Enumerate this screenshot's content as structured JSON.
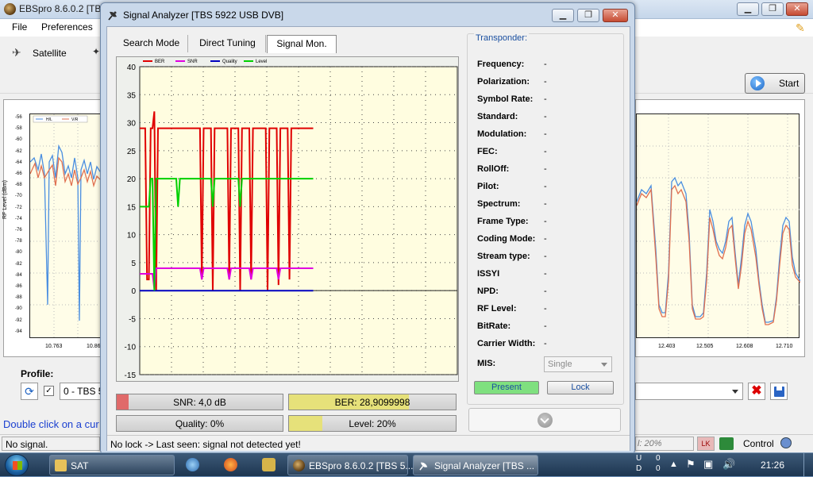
{
  "main_window": {
    "title": "EBSpro 8.6.0.2 [TBS",
    "menu": [
      "File",
      "Preferences"
    ],
    "toolbar_satellite": "Satellite",
    "start_label": "Start",
    "profile_label": "Profile:",
    "profile_value": "0 - TBS 5",
    "hint_text": "Double click on a cur",
    "status_text": "No signal.",
    "status_level": "l: 20%",
    "status_lk": "LK",
    "control_label": "Control",
    "spectrum_left_ylabel": "RF Level (dBm)",
    "spectrum_left_yticks": [
      "-56",
      "-58",
      "-60",
      "-62",
      "-64",
      "-66",
      "-68",
      "-70",
      "-72",
      "-74",
      "-76",
      "-78",
      "-80",
      "-82",
      "-84",
      "-86",
      "-88",
      "-90",
      "-92",
      "-94"
    ],
    "spectrum_left_xticks": [
      "10.763",
      "10.865"
    ],
    "spectrum_left_legend": [
      "H/L",
      "V/R"
    ],
    "spectrum_right_xticks": [
      "12.403",
      "12.505",
      "12.608",
      "12.710"
    ]
  },
  "dialog": {
    "title": "Signal Analyzer [TBS 5922 USB DVB]",
    "tabs": [
      "Search Mode",
      "Direct Tuning",
      "Signal Mon."
    ],
    "meters": {
      "snr": {
        "label": "SNR: 4,0 dB",
        "fraction": 0.07,
        "color": "#e06a6a"
      },
      "ber": {
        "label": "BER: 28,9099998",
        "fraction": 0.72,
        "color": "#e6e17a"
      },
      "quality": {
        "label": "Quality: 0%",
        "fraction": 0.0,
        "color": "#e06a6a"
      },
      "level": {
        "label": "Level: 20%",
        "fraction": 0.2,
        "color": "#e6e17a"
      }
    },
    "transponder_heading": "Transponder:",
    "transponder": [
      {
        "label": "Frequency:",
        "value": "-"
      },
      {
        "label": "Polarization:",
        "value": "-"
      },
      {
        "label": "Symbol Rate:",
        "value": "-"
      },
      {
        "label": "Standard:",
        "value": "-"
      },
      {
        "label": "Modulation:",
        "value": "-"
      },
      {
        "label": "FEC:",
        "value": "-"
      },
      {
        "label": "RollOff:",
        "value": "-"
      },
      {
        "label": "Pilot:",
        "value": "-"
      },
      {
        "label": "Spectrum:",
        "value": "-"
      },
      {
        "label": "Frame Type:",
        "value": "-"
      },
      {
        "label": "Coding Mode:",
        "value": "-"
      },
      {
        "label": "Stream type:",
        "value": "-"
      },
      {
        "label": "ISSYI",
        "value": "-"
      },
      {
        "label": "NPD:",
        "value": "-"
      },
      {
        "label": "RF Level:",
        "value": "-"
      },
      {
        "label": "BitRate:",
        "value": "-"
      },
      {
        "label": "Carrier Width:",
        "value": "-"
      }
    ],
    "mis_label": "MIS:",
    "mis_value": "Single",
    "present_label": "Present",
    "lock_label": "Lock",
    "status_text": "No lock -> Last seen: signal not detected yet!",
    "colors": {
      "present_green": "#7fe07f",
      "lock_blue": "#1a4fa0"
    }
  },
  "chart_data": {
    "type": "line",
    "ylim": [
      -15,
      40
    ],
    "yticks": [
      "40",
      "35",
      "30",
      "25",
      "20",
      "15",
      "10",
      "5",
      "0",
      "-5",
      "-10",
      "-15"
    ],
    "legend": [
      "BER",
      "SNR",
      "Quality",
      "Level"
    ],
    "series": [
      {
        "name": "BER",
        "color": "#e00000",
        "values": [
          29,
          29,
          29,
          29,
          2,
          2,
          29,
          29,
          32,
          0,
          29,
          29,
          29,
          29,
          29,
          29,
          29,
          29,
          29,
          29,
          29,
          29,
          29,
          29,
          29,
          29,
          29,
          29,
          29,
          29,
          29,
          29,
          29,
          29,
          2,
          29,
          29,
          29,
          29,
          29,
          0,
          29,
          29,
          29,
          29,
          29,
          29,
          29,
          29,
          2,
          29,
          29,
          29,
          29,
          29,
          0,
          29,
          29,
          29,
          29,
          29,
          2,
          29,
          29,
          29,
          29,
          29,
          29,
          29,
          29,
          0,
          29,
          29,
          29,
          29,
          29,
          1,
          29,
          29,
          29,
          29,
          29,
          2,
          29,
          29,
          29,
          29,
          29,
          29,
          29,
          29,
          29,
          29,
          29,
          29,
          29
        ]
      },
      {
        "name": "SNR",
        "color": "#e000e0",
        "values": [
          3,
          3,
          3,
          3,
          3,
          3,
          3,
          3,
          0.3,
          4,
          4,
          4,
          4,
          4,
          4,
          4,
          4,
          4,
          4,
          4,
          4,
          4,
          4,
          4,
          4,
          4,
          4,
          4,
          4,
          4,
          4,
          4,
          4,
          4,
          2,
          4,
          4,
          4,
          4,
          4,
          4,
          4,
          4,
          4,
          4,
          4,
          4,
          4,
          4,
          2,
          4,
          4,
          4,
          4,
          4,
          4,
          4,
          4,
          4,
          4,
          4,
          2,
          4,
          4,
          4,
          4,
          4,
          4,
          4,
          4,
          4,
          4,
          4,
          4,
          4,
          4,
          2,
          4,
          4,
          4,
          4,
          4,
          4,
          4,
          4,
          4,
          4,
          4,
          4,
          4,
          4,
          4,
          4,
          4,
          4,
          4
        ]
      },
      {
        "name": "Quality",
        "color": "#0000c0",
        "values": [
          0,
          0,
          0,
          0,
          0,
          0,
          0,
          0,
          0,
          0,
          0,
          0,
          0,
          0,
          0,
          0,
          0,
          0,
          0,
          0,
          0,
          0,
          0,
          0,
          0,
          0,
          0,
          0,
          0,
          0,
          0,
          0,
          0,
          0,
          0,
          0,
          0,
          0,
          0,
          0,
          0,
          0,
          0,
          0,
          0,
          0,
          0,
          0,
          0,
          0,
          0,
          0,
          0,
          0,
          0,
          0,
          0,
          0,
          0,
          0,
          0,
          0,
          0,
          0,
          0,
          0,
          0,
          0,
          0,
          0,
          0,
          0,
          0,
          0,
          0,
          0,
          0,
          0,
          0,
          0,
          0,
          0,
          0,
          0,
          0,
          0,
          0,
          0,
          0,
          0,
          0,
          0,
          0,
          0,
          0,
          0
        ]
      },
      {
        "name": "Level",
        "color": "#00d000",
        "values": [
          15,
          15,
          15,
          15,
          15,
          15,
          20,
          20,
          0,
          20,
          20,
          20,
          20,
          20,
          20,
          20,
          20,
          20,
          20,
          20,
          20,
          15,
          20,
          20,
          20,
          20,
          20,
          20,
          20,
          20,
          20,
          20,
          20,
          20,
          20,
          20,
          20,
          20,
          20,
          20,
          15,
          20,
          20,
          20,
          20,
          20,
          20,
          20,
          20,
          20,
          20,
          20,
          20,
          20,
          20,
          15,
          20,
          20,
          20,
          20,
          20,
          20,
          20,
          20,
          20,
          20,
          20,
          20,
          20,
          20,
          20,
          20,
          20,
          20,
          20,
          20,
          20,
          20,
          20,
          20,
          20,
          20,
          20,
          20,
          20,
          20,
          20,
          20,
          20,
          20,
          20,
          20,
          20,
          20,
          20,
          20
        ]
      }
    ],
    "grid": true,
    "legend_position": "top-left"
  },
  "taskbar": {
    "folder_label": "SAT",
    "ebspro_label": "EBSpro 8.6.0.2 [TBS 5...",
    "analyzer_label": "Signal Analyzer [TBS ...",
    "tray_u": "U",
    "tray_d": "D",
    "tray_u_val": "0",
    "tray_d_val": "0",
    "clock": "21:26"
  }
}
